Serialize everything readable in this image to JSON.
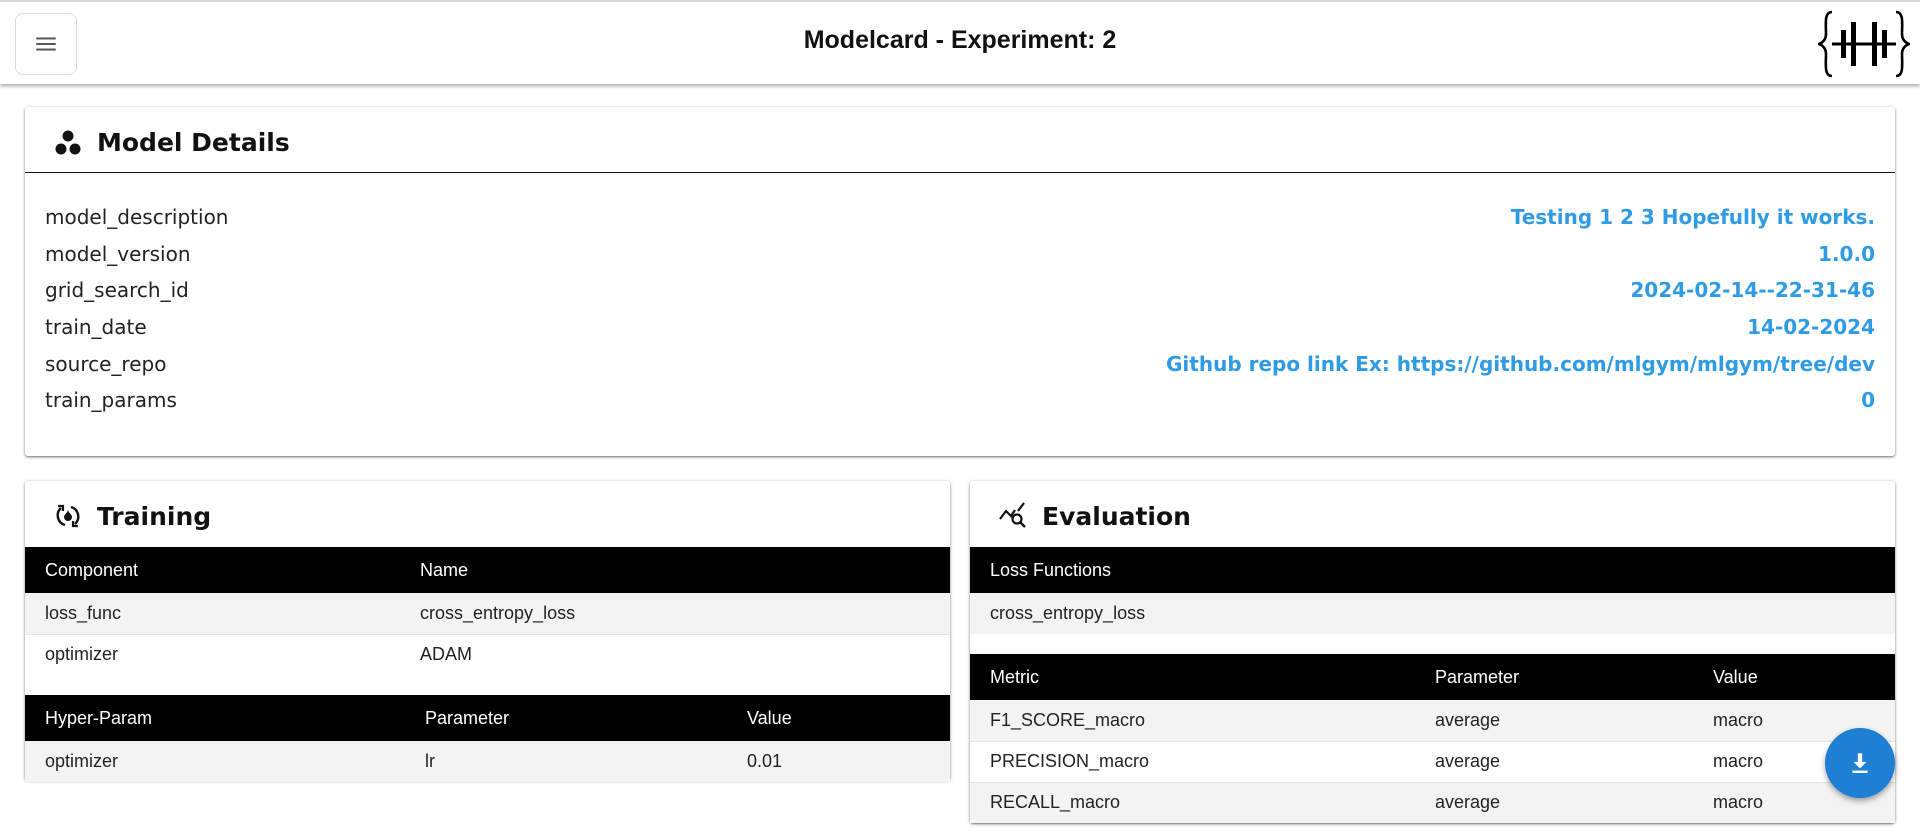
{
  "header": {
    "title": "Modelcard - Experiment: 2"
  },
  "details": {
    "title": "Model Details",
    "rows": [
      {
        "key": "model_description",
        "value": "Testing 1 2 3 Hopefully it works."
      },
      {
        "key": "model_version",
        "value": "1.0.0"
      },
      {
        "key": "grid_search_id",
        "value": "2024-02-14--22-31-46"
      },
      {
        "key": "train_date",
        "value": "14-02-2024"
      },
      {
        "key": "source_repo",
        "value": "Github repo link Ex: https://github.com/mlgym/mlgym/tree/dev"
      },
      {
        "key": "train_params",
        "value": "0"
      }
    ]
  },
  "training": {
    "title": "Training",
    "components_table": {
      "headers": [
        "Component",
        "Name"
      ],
      "rows": [
        [
          "loss_func",
          "cross_entropy_loss"
        ],
        [
          "optimizer",
          "ADAM"
        ]
      ]
    },
    "hyperparams_table": {
      "headers": [
        "Hyper-Param",
        "Parameter",
        "Value"
      ],
      "rows": [
        [
          "optimizer",
          "lr",
          "0.01"
        ]
      ]
    }
  },
  "evaluation": {
    "title": "Evaluation",
    "loss_table": {
      "headers": [
        "Loss Functions"
      ],
      "rows": [
        [
          "cross_entropy_loss"
        ]
      ]
    },
    "metrics_table": {
      "headers": [
        "Metric",
        "Parameter",
        "Value"
      ],
      "rows": [
        [
          "F1_SCORE_macro",
          "average",
          "macro"
        ],
        [
          "PRECISION_macro",
          "average",
          "macro"
        ],
        [
          "RECALL_macro",
          "average",
          "macro"
        ]
      ]
    }
  },
  "colors": {
    "accent": "#2f9be4",
    "fab": "#1e7fd3",
    "table_header": "#000000"
  },
  "icons": {
    "menu": "menu-icon",
    "logo": "logo-icon",
    "details": "bubble-chart-icon",
    "training": "cycle-icon",
    "evaluation": "query-stats-icon",
    "download": "download-icon"
  }
}
